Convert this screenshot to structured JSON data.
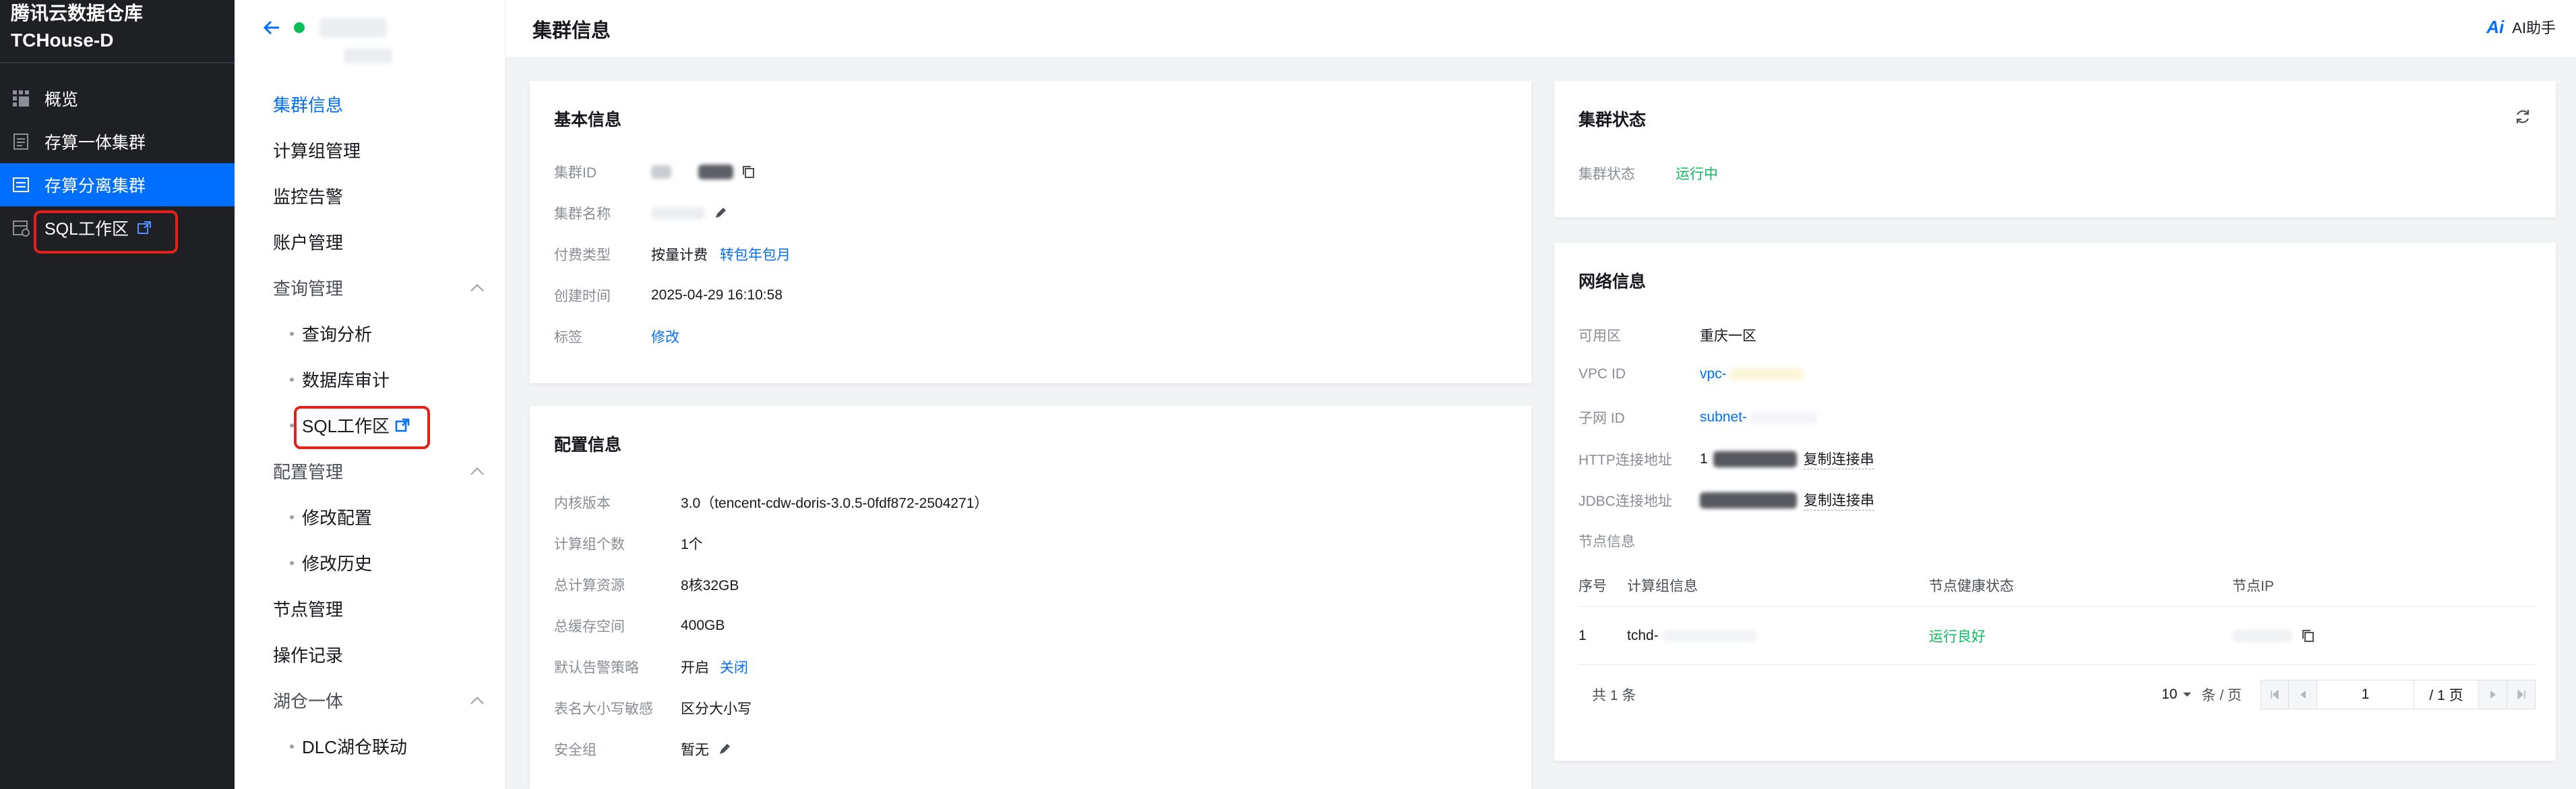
{
  "app": {
    "brand_line1": "腾讯云数据仓库",
    "brand_line2": "TCHouse-D"
  },
  "sidebar": {
    "items": [
      {
        "label": "概览",
        "icon": "grid-icon"
      },
      {
        "label": "存算一体集群",
        "icon": "document-icon"
      },
      {
        "label": "存算分离集群",
        "icon": "list-icon",
        "active": true
      },
      {
        "label": "SQL工作区",
        "icon": "database-icon",
        "external": true
      }
    ]
  },
  "subnav": {
    "items": [
      {
        "label": "集群信息",
        "active": true
      },
      {
        "label": "计算组管理"
      },
      {
        "label": "监控告警"
      },
      {
        "label": "账户管理"
      }
    ],
    "groups": {
      "query": {
        "label": "查询管理",
        "children": [
          "查询分析",
          "数据库审计",
          "SQL工作区"
        ]
      },
      "config": {
        "label": "配置管理",
        "children": [
          "修改配置",
          "修改历史"
        ]
      },
      "node_mgmt": "节点管理",
      "op_log": "操作记录",
      "lakehouse": {
        "label": "湖仓一体",
        "children": [
          "DLC湖仓联动"
        ]
      }
    }
  },
  "header": {
    "title": "集群信息",
    "ai_label": "AI助手",
    "ai_mark": "Ai"
  },
  "basic": {
    "title": "基本信息",
    "cluster_id_label": "集群ID",
    "cluster_name_label": "集群名称",
    "pay_type_label": "付费类型",
    "pay_type_value": "按量计费",
    "pay_type_link": "转包年包月",
    "created_label": "创建时间",
    "created_value": "2025-04-29 16:10:58",
    "tags_label": "标签",
    "tags_link": "修改"
  },
  "config": {
    "title": "配置信息",
    "kernel_label": "内核版本",
    "kernel_value": "3.0（tencent-cdw-doris-3.0.5-0fdf872-2504271）",
    "compute_groups_label": "计算组个数",
    "compute_groups_value": "1个",
    "total_compute_label": "总计算资源",
    "total_compute_value": "8核32GB",
    "total_cache_label": "总缓存空间",
    "total_cache_value": "400GB",
    "alarm_label": "默认告警策略",
    "alarm_value": "开启",
    "alarm_link": "关闭",
    "case_label": "表名大小写敏感",
    "case_value": "区分大小写",
    "sg_label": "安全组",
    "sg_value": "暂无"
  },
  "status": {
    "title": "集群状态",
    "label": "集群状态",
    "value": "运行中"
  },
  "network": {
    "title": "网络信息",
    "zone_label": "可用区",
    "zone_value": "重庆一区",
    "vpc_label": "VPC ID",
    "vpc_value": "vpc-",
    "subnet_label": "子网 ID",
    "subnet_value": "subnet-",
    "http_label": "HTTP连接地址",
    "http_prefix": "1",
    "jdbc_label": "JDBC连接地址",
    "copy_label": "复制连接串",
    "nodes_label": "节点信息",
    "table": {
      "headers": [
        "序号",
        "计算组信息",
        "节点健康状态",
        "节点IP"
      ],
      "rows": [
        {
          "index": "1",
          "group": "tchd-",
          "health": "运行良好"
        }
      ]
    },
    "pager": {
      "total": "共 1 条",
      "page_size": "10",
      "per_page": "条 / 页",
      "current": "1",
      "pages": "/ 1 页"
    }
  },
  "colors": {
    "accent": "#006eff",
    "success": "#0abf5b",
    "sidebar_bg": "#1f2024",
    "highlight": "#e3201b"
  }
}
